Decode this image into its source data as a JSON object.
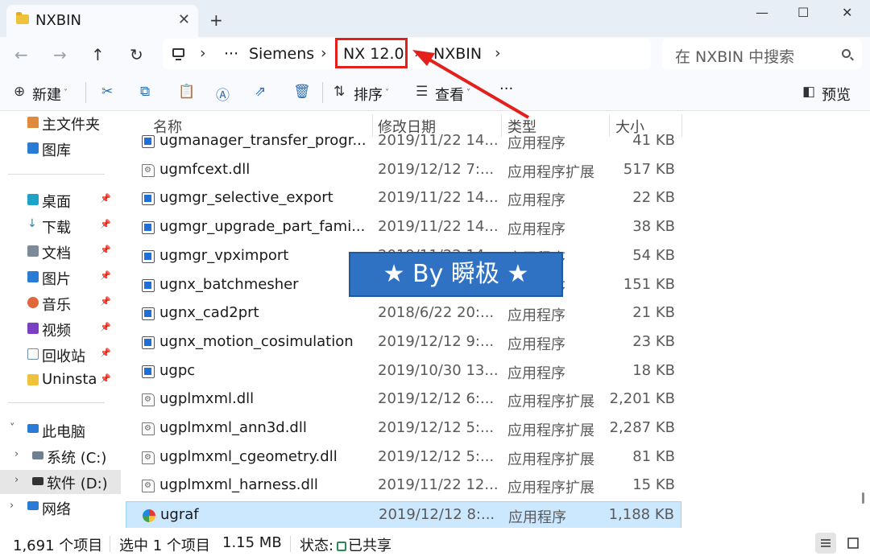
{
  "window": {
    "tab_title": "NXBIN",
    "tab_close": "✕",
    "new_tab": "+",
    "minimize": "—",
    "maximize": "☐",
    "close": "✕"
  },
  "nav": {
    "back": "←",
    "forward": "→",
    "up": "↑",
    "refresh": "↻",
    "chevron": "›",
    "ellipsis": "···",
    "breadcrumbs": [
      "Siemens",
      "NX 12.0",
      "NXBIN"
    ],
    "search_placeholder": "在 NXBIN 中搜索"
  },
  "toolbar": {
    "new_label": "新建",
    "sort_label": "排序",
    "view_label": "查看",
    "more_label": "···",
    "preview_label": "预览",
    "accent": "#2b6cb0"
  },
  "sidebar": {
    "home": "主文件夹",
    "gallery": "图库",
    "quick": [
      "桌面",
      "下载",
      "文档",
      "图片",
      "音乐",
      "视频",
      "回收站",
      "Uninsta"
    ],
    "this_pc": "此电脑",
    "drive_c": "系统 (C:)",
    "drive_d": "软件 (D:)",
    "network": "网络"
  },
  "columns": {
    "name": "名称",
    "date": "修改日期",
    "type": "类型",
    "size": "大小"
  },
  "files": [
    {
      "name": "ugmanager_transfer_progr...",
      "date": "2019/11/22 14...",
      "type": "应用程序",
      "size": "41 KB",
      "icon": "exe"
    },
    {
      "name": "ugmfcext.dll",
      "date": "2019/12/12 7:...",
      "type": "应用程序扩展",
      "size": "517 KB",
      "icon": "dll"
    },
    {
      "name": "ugmgr_selective_export",
      "date": "2019/11/22 14...",
      "type": "应用程序",
      "size": "22 KB",
      "icon": "exe"
    },
    {
      "name": "ugmgr_upgrade_part_fami...",
      "date": "2019/11/22 14...",
      "type": "应用程序",
      "size": "38 KB",
      "icon": "exe"
    },
    {
      "name": "ugmgr_vpximport",
      "date": "2019/11/22 14...",
      "type": "应用程序",
      "size": "54 KB",
      "icon": "exe"
    },
    {
      "name": "ugnx_batchmesher",
      "date": "2019/12/12 7:...",
      "type": "应用程序",
      "size": "151 KB",
      "icon": "exe"
    },
    {
      "name": "ugnx_cad2prt",
      "date": "2018/6/22 20:...",
      "type": "应用程序",
      "size": "21 KB",
      "icon": "exe"
    },
    {
      "name": "ugnx_motion_cosimulation",
      "date": "2019/12/12 9:...",
      "type": "应用程序",
      "size": "23 KB",
      "icon": "exe"
    },
    {
      "name": "ugpc",
      "date": "2019/10/30 13...",
      "type": "应用程序",
      "size": "18 KB",
      "icon": "exe"
    },
    {
      "name": "ugplmxml.dll",
      "date": "2019/12/12 6:...",
      "type": "应用程序扩展",
      "size": "2,201 KB",
      "icon": "dll"
    },
    {
      "name": "ugplmxml_ann3d.dll",
      "date": "2019/12/12 5:...",
      "type": "应用程序扩展",
      "size": "2,287 KB",
      "icon": "dll"
    },
    {
      "name": "ugplmxml_cgeometry.dll",
      "date": "2019/12/12 5:...",
      "type": "应用程序扩展",
      "size": "81 KB",
      "icon": "dll"
    },
    {
      "name": "ugplmxml_harness.dll",
      "date": "2019/11/22 12...",
      "type": "应用程序扩展",
      "size": "15 KB",
      "icon": "dll"
    },
    {
      "name": "ugraf",
      "date": "2019/12/12 8:...",
      "type": "应用程序",
      "size": "1,188 KB",
      "icon": "app",
      "selected": true
    }
  ],
  "watermark": "★ By 瞬极 ★",
  "status": {
    "item_count": "1,691 个项目",
    "selected": "选中 1 个项目",
    "selected_size": "1.15 MB",
    "state_label": "状态:",
    "state_value": "已共享"
  },
  "colors": {
    "highlight_red": "#e3201b",
    "selection": "#cce8ff",
    "watermark_blue": "#2f72c4"
  }
}
